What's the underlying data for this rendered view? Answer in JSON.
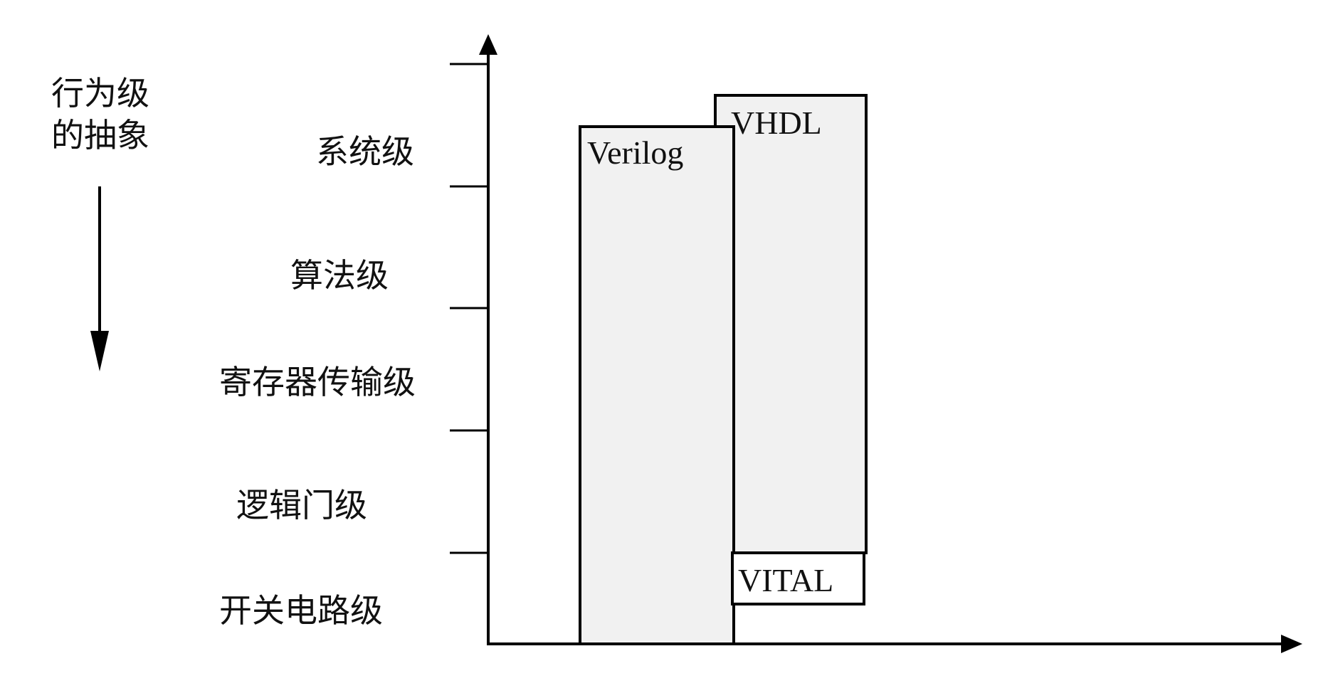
{
  "caption": {
    "line1": "行为级",
    "line2": "的抽象"
  },
  "levels": [
    {
      "label": "系统级"
    },
    {
      "label": "算法级"
    },
    {
      "label": "寄存器传输级"
    },
    {
      "label": "逻辑门级"
    },
    {
      "label": "开关电路级"
    }
  ],
  "languages": {
    "verilog": "Verilog",
    "vhdl": "VHDL",
    "vital": "VITAL"
  },
  "colors": {
    "box_fill": "#f1f1f1",
    "line": "#000000",
    "vital_fill": "#ffffff"
  }
}
